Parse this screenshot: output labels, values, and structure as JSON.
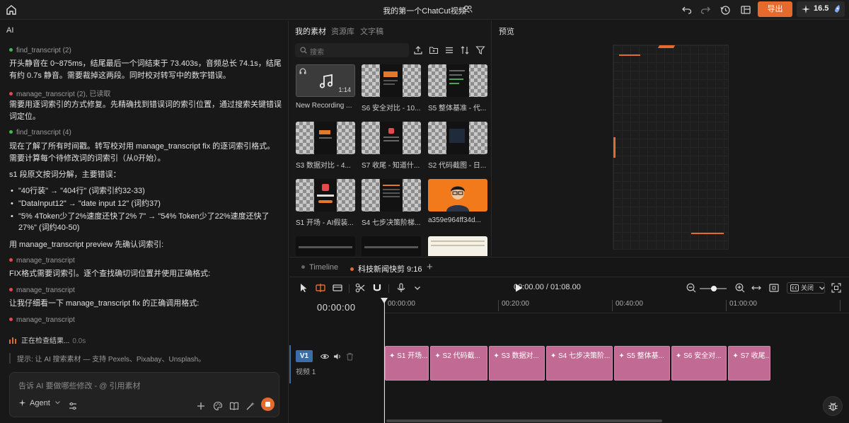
{
  "topbar": {
    "title": "我的第一个ChatCut视频",
    "export_label": "导出",
    "credits": "16.5"
  },
  "ai": {
    "panel_label": "AI",
    "items": [
      {
        "kind": "tool",
        "status": "green",
        "text": "find_transcript (2)"
      },
      {
        "kind": "msg",
        "text": "开头静音在 0~875ms，结尾最后一个词结束于 73.403s，音频总长 74.1s，结尾有约 0.7s 静音。需要裁掉这两段。同时校对转写中的数字错误。"
      },
      {
        "kind": "tool",
        "status": "red",
        "text": "manage_transcript (2), 已读取"
      },
      {
        "kind": "msg",
        "text": "需要用逐词索引的方式修复。先精确找到错误词的索引位置，通过搜索关键错误词定位。"
      },
      {
        "kind": "tool",
        "status": "green",
        "text": "find_transcript (4)"
      },
      {
        "kind": "msg",
        "text": "现在了解了所有时间戳。转写校对用 manage_transcript fix 的逐词索引格式。需要计算每个待修改词的词索引（从0开始）。"
      },
      {
        "kind": "msg",
        "text": "s1 段原文按词分解，主要错误："
      },
      {
        "kind": "bullets",
        "items": [
          "\"40行装\" → \"404行\" (词索引约32-33)",
          "\"DataInput12\" → \"date input 12\" (词约37)",
          "\"5% 4Token少了2%速度还快了2% 7\" → \"54% Token少了22%速度还快了27%\" (词约40-50)"
        ]
      },
      {
        "kind": "msg",
        "text": "用 manage_transcript preview 先确认词索引:"
      },
      {
        "kind": "tool",
        "status": "red",
        "text": "manage_transcript"
      },
      {
        "kind": "msg",
        "text": "FIX格式需要词索引。逐个查找确切词位置并使用正确格式:"
      },
      {
        "kind": "tool",
        "status": "red",
        "text": "manage_transcript"
      },
      {
        "kind": "msg",
        "text": "让我仔细看一下 manage_transcript fix 的正确调用格式:"
      },
      {
        "kind": "tool",
        "status": "red",
        "text": "manage_transcript"
      }
    ],
    "checking": {
      "label": "正在检查结果...",
      "time": "0.0s"
    },
    "hint": "提示:  让 AI 搜索素材 — 支持 Pexels、Pixabay、Unsplash。",
    "input_placeholder": "告诉 AI 要做哪些修改 - @ 引用素材",
    "agent_label": "Agent"
  },
  "media": {
    "tabs": [
      "我的素材",
      "资源库",
      "文字稿"
    ],
    "search_placeholder": "搜索",
    "tiles": [
      {
        "label": "New Recording ...",
        "style": "audio",
        "duration": "1:14"
      },
      {
        "label": "S6 安全对比 - 10...",
        "style": "checker"
      },
      {
        "label": "S5 整体基准 - 代...",
        "style": "checker"
      },
      {
        "label": "S3 数据对比 - 4...",
        "style": "checker"
      },
      {
        "label": "S7 收尾 - 知道什...",
        "style": "checker"
      },
      {
        "label": "S2 代码截图 - 日...",
        "style": "checker"
      },
      {
        "label": "S1 开场 - AI假装...",
        "style": "checker"
      },
      {
        "label": "S4 七步决策阶梯...",
        "style": "checker"
      },
      {
        "label": "a359e964ff34d...",
        "style": "orange"
      },
      {
        "label": "",
        "style": "dark"
      },
      {
        "label": "",
        "style": "dark"
      },
      {
        "label": "",
        "style": "light"
      }
    ]
  },
  "preview": {
    "label": "预览"
  },
  "timeline": {
    "tabs": [
      {
        "label": "Timeline",
        "dot": "#666666"
      },
      {
        "label": "科技新闻快剪 9:16",
        "dot": "#e6692e"
      }
    ],
    "playback": "00:00.00 / 01:08.00",
    "cc_label": "关闭",
    "timecode": "00:00:00",
    "ruler": [
      "00:00:00",
      "00:20:00",
      "00:40:00",
      "01:00:00"
    ],
    "track": {
      "badge": "V1",
      "name": "视频 1"
    },
    "clips": [
      {
        "label": "S1 开场...",
        "start_s": 0.0,
        "end_s": 8.0
      },
      {
        "label": "S2 代码截...",
        "start_s": 8.0,
        "end_s": 18.3
      },
      {
        "label": "S3 数据对...",
        "start_s": 18.3,
        "end_s": 28.3
      },
      {
        "label": "S4 七步决策阶...",
        "start_s": 28.3,
        "end_s": 40.3
      },
      {
        "label": "S5 整体基...",
        "start_s": 40.3,
        "end_s": 50.3
      },
      {
        "label": "S6 安全对...",
        "start_s": 50.3,
        "end_s": 60.3
      },
      {
        "label": "S7 收尾...",
        "start_s": 60.3,
        "end_s": 68.0
      }
    ]
  }
}
